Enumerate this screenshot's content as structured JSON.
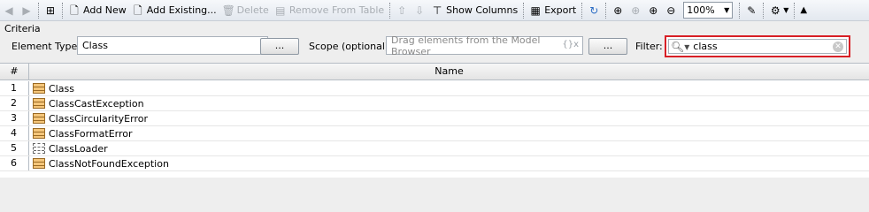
{
  "toolbar": {
    "add_new": "Add New",
    "add_existing": "Add Existing...",
    "delete": "Delete",
    "remove_from_table": "Remove From Table",
    "show_columns": "Show Columns",
    "export": "Export",
    "zoom_value": "100%"
  },
  "criteria": {
    "title": "Criteria",
    "element_type_label": "Element Type:",
    "element_type_value": "Class",
    "browse_label": "...",
    "scope_label": "Scope (optional):",
    "scope_placeholder": "Drag elements from the Model Browser",
    "scope_fx": "{}x",
    "filter_label": "Filter:",
    "filter_value": "class"
  },
  "table": {
    "columns": [
      "#",
      "Name"
    ],
    "rows": [
      {
        "num": "1",
        "name": "Class",
        "icon": "class-icon"
      },
      {
        "num": "2",
        "name": "ClassCastException",
        "icon": "class-icon"
      },
      {
        "num": "3",
        "name": "ClassCircularityError",
        "icon": "class-icon"
      },
      {
        "num": "4",
        "name": "ClassFormatError",
        "icon": "class-icon"
      },
      {
        "num": "5",
        "name": "ClassLoader",
        "icon": "abstract-class-icon"
      },
      {
        "num": "6",
        "name": "ClassNotFoundException",
        "icon": "class-icon"
      }
    ]
  },
  "colors": {
    "filter_highlight": "#d81f26",
    "class_icon_fill": "#f5c67a"
  }
}
